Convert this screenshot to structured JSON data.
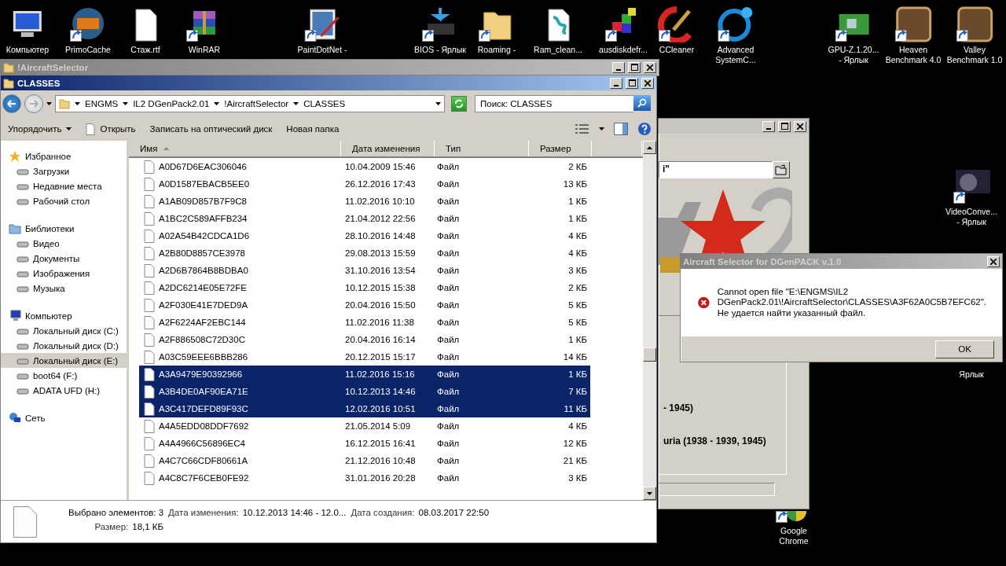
{
  "desktop": {
    "icons": [
      {
        "label": [
          "Компьютер"
        ],
        "shortcut": false
      },
      {
        "label": [
          "PrimoCache"
        ],
        "shortcut": true
      },
      {
        "label": [
          "Стаж.rtf"
        ],
        "shortcut": false
      },
      {
        "label": [
          "WinRAR"
        ],
        "shortcut": true
      },
      {
        "label": [
          "PaintDotNet -"
        ],
        "shortcut": true
      },
      {
        "label": [
          "BIOS - Ярлык"
        ],
        "shortcut": true
      },
      {
        "label": [
          "Roaming -"
        ],
        "shortcut": true
      },
      {
        "label": [
          "Ram_clean..."
        ],
        "shortcut": false
      },
      {
        "label": [
          "ausdiskdefr..."
        ],
        "shortcut": true
      },
      {
        "label": [
          "CCleaner"
        ],
        "shortcut": true
      },
      {
        "label": [
          "Advanced",
          "SystemC..."
        ],
        "shortcut": true
      },
      {
        "label": [
          "GPU-Z.1.20...",
          "- Ярлык"
        ],
        "shortcut": true
      },
      {
        "label": [
          "Heaven",
          "Benchmark 4.0"
        ],
        "shortcut": true
      },
      {
        "label": [
          "Valley",
          "Benchmark 1.0"
        ],
        "shortcut": true
      },
      {
        "label": [
          "VideoConve...",
          "- Ярлык"
        ],
        "shortcut": true
      },
      {
        "label": [
          "Ярлык"
        ]
      },
      {
        "label": [
          "Google",
          "Chrome"
        ],
        "shortcut": true
      }
    ]
  },
  "back_window": {
    "title": "!AircraftSelector"
  },
  "explorer": {
    "title": "CLASSES",
    "breadcrumbs": [
      "ENGMS",
      "IL2 DGenPack2.01",
      "!AircraftSelector",
      "CLASSES"
    ],
    "search": {
      "placeholder": "Поиск: CLASSES"
    },
    "toolbar": [
      {
        "label": "Упорядочить",
        "kind": "menu"
      },
      {
        "label": "Открыть",
        "kind": "open"
      },
      {
        "label": "Записать на оптический диск",
        "kind": "plain"
      },
      {
        "label": "Новая папка",
        "kind": "plain"
      }
    ],
    "nav": [
      {
        "label": "Избранное",
        "selected": false,
        "children": [
          {
            "label": "Загрузки",
            "selected": false
          },
          {
            "label": "Недавние места",
            "selected": false
          },
          {
            "label": "Рабочий стол",
            "selected": false
          }
        ]
      },
      {
        "label": "Библиотеки",
        "selected": false,
        "children": [
          {
            "label": "Видео",
            "selected": false
          },
          {
            "label": "Документы",
            "selected": false
          },
          {
            "label": "Изображения",
            "selected": false
          },
          {
            "label": "Музыка",
            "selected": false
          }
        ]
      },
      {
        "label": "Компьютер",
        "selected": false,
        "children": [
          {
            "label": "Локальный диск (C:)",
            "selected": false
          },
          {
            "label": "Локальный диск (D:)",
            "selected": false
          },
          {
            "label": "Локальный диск (E:)",
            "selected": true
          },
          {
            "label": "boot64 (F:)",
            "selected": false
          },
          {
            "label": "ADATA UFD (H:)",
            "selected": false
          }
        ]
      },
      {
        "label": "Сеть",
        "selected": false
      }
    ],
    "table": {
      "columns": [
        {
          "label": "Имя",
          "sorted": true
        },
        {
          "label": "Дата изменения",
          "sorted": false
        },
        {
          "label": "Тип",
          "sorted": false
        },
        {
          "label": "Размер",
          "sorted": false
        }
      ],
      "rows": [
        {
          "name": "A0D67D6EAC306046",
          "date": "10.04.2009 15:46",
          "type": "Файл",
          "size": "2 КБ",
          "selected": false
        },
        {
          "name": "A0D1587EBACB5EE0",
          "date": "26.12.2016 17:43",
          "type": "Файл",
          "size": "13 КБ",
          "selected": false
        },
        {
          "name": "A1AB09D857B7F9C8",
          "date": "11.02.2016 10:10",
          "type": "Файл",
          "size": "1 КБ",
          "selected": false
        },
        {
          "name": "A1BC2C589AFFB234",
          "date": "21.04.2012 22:56",
          "type": "Файл",
          "size": "1 КБ",
          "selected": false
        },
        {
          "name": "A02A54B42CDCA1D6",
          "date": "28.10.2016 14:48",
          "type": "Файл",
          "size": "4 КБ",
          "selected": false
        },
        {
          "name": "A2B80D8857CE3978",
          "date": "29.08.2013 15:59",
          "type": "Файл",
          "size": "4 КБ",
          "selected": false
        },
        {
          "name": "A2D6B7864B8BDBA0",
          "date": "31.10.2016 13:54",
          "type": "Файл",
          "size": "3 КБ",
          "selected": false
        },
        {
          "name": "A2DC6214E05E72FE",
          "date": "10.12.2015 15:38",
          "type": "Файл",
          "size": "2 КБ",
          "selected": false
        },
        {
          "name": "A2F030E41E7DED9A",
          "date": "20.04.2016 15:50",
          "type": "Файл",
          "size": "5 КБ",
          "selected": false
        },
        {
          "name": "A2F6224AF2EBC144",
          "date": "11.02.2016 11:38",
          "type": "Файл",
          "size": "5 КБ",
          "selected": false
        },
        {
          "name": "A2F886508C72D30C",
          "date": "20.04.2016 16:14",
          "type": "Файл",
          "size": "1 КБ",
          "selected": false
        },
        {
          "name": "A03C59EEE6BBB286",
          "date": "20.12.2015 15:17",
          "type": "Файл",
          "size": "14 КБ",
          "selected": false
        },
        {
          "name": "A3A9479E90392966",
          "date": "11.02.2016 15:16",
          "type": "Файл",
          "size": "1 КБ",
          "selected": true
        },
        {
          "name": "A3B4DE0AF90EA71E",
          "date": "10.12.2013 14:46",
          "type": "Файл",
          "size": "7 КБ",
          "selected": true
        },
        {
          "name": "A3C417DEFD89F93C",
          "date": "12.02.2016 10:51",
          "type": "Файл",
          "size": "11 КБ",
          "selected": true
        },
        {
          "name": "A4A5EDD08DDF7692",
          "date": "21.05.2014 5:09",
          "type": "Файл",
          "size": "4 КБ",
          "selected": false
        },
        {
          "name": "A4A4966C56896EC4",
          "date": "16.12.2015 16:41",
          "type": "Файл",
          "size": "12 КБ",
          "selected": false
        },
        {
          "name": "A4C7C66CDF80661A",
          "date": "21.12.2016 10:48",
          "type": "Файл",
          "size": "21 КБ",
          "selected": false
        },
        {
          "name": "A4C8C7F6CEB0FE92",
          "date": "31.01.2016 20:28",
          "type": "Файл",
          "size": "3 КБ",
          "selected": false
        }
      ]
    },
    "status": {
      "count": "Выбрано элементов: 3",
      "fields": [
        {
          "label": "Дата изменения:",
          "value": "10.12.2013 14:46 - 12.0..."
        },
        {
          "label": "Дата создания:",
          "value": "08.03.2017 22:50"
        },
        {
          "label": "Размер:",
          "value": "18,1 КБ"
        }
      ]
    }
  },
  "app_window": {
    "field_value": "i\"",
    "lines": [
      "- 1945)",
      "uria (1938 - 1939, 1945)"
    ]
  },
  "dialog": {
    "title": "Aircraft Selector for DGenPACK v.1.0",
    "message": [
      "Cannot open file \"E:\\ENGMS\\IL2",
      "DGenPack2.01\\!AircraftSelector\\CLASSES\\A3F62A0C5B7EFC62\".",
      "Не удается найти указанный файл."
    ],
    "button": "OK"
  }
}
